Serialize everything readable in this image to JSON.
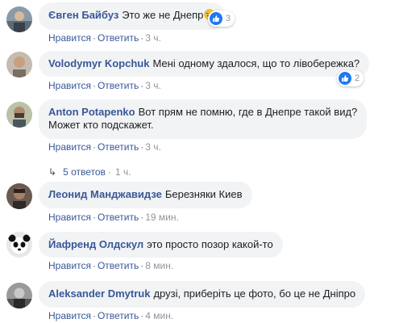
{
  "comments": [
    {
      "author": "Євген Байбуз",
      "text": "Это же не Днепр",
      "emoji": "laughing-face-emoji",
      "reaction_count": "3",
      "like_label": "Нравится",
      "reply_label": "Ответить",
      "time": "3 ч."
    },
    {
      "author": "Volodymyr Kopchuk",
      "text": "Мені одному здалося, що то лівобережка?",
      "reaction_count": "2",
      "like_label": "Нравится",
      "reply_label": "Ответить",
      "time": "3 ч."
    },
    {
      "author": "Anton Potapenko",
      "text_line1": "Вот прям не помню, где в Днепре такой вид?",
      "text_line2": "Может кто подскажет.",
      "like_label": "Нравится",
      "reply_label": "Ответить",
      "time": "3 ч.",
      "replies_label": "5 ответов",
      "replies_time": "1 ч."
    },
    {
      "author": "Леонид Манджавидзе",
      "text": "Березняки Киев",
      "like_label": "Нравится",
      "reply_label": "Ответить",
      "time": "19 мин."
    },
    {
      "author": "Йафренд Олдскул",
      "text": "это просто позор какой-то",
      "like_label": "Нравится",
      "reply_label": "Ответить",
      "time": "8 мин."
    },
    {
      "author": "Aleksander Dmytruk",
      "text": "друзі, приберіть це фото, бо це не Дніпро",
      "like_label": "Нравится",
      "reply_label": "Ответить",
      "time": "4 мин."
    }
  ],
  "colors": {
    "author": "#385898",
    "bubble": "#f2f3f5",
    "like_badge": "#2078f4",
    "meta": "#90949c"
  }
}
